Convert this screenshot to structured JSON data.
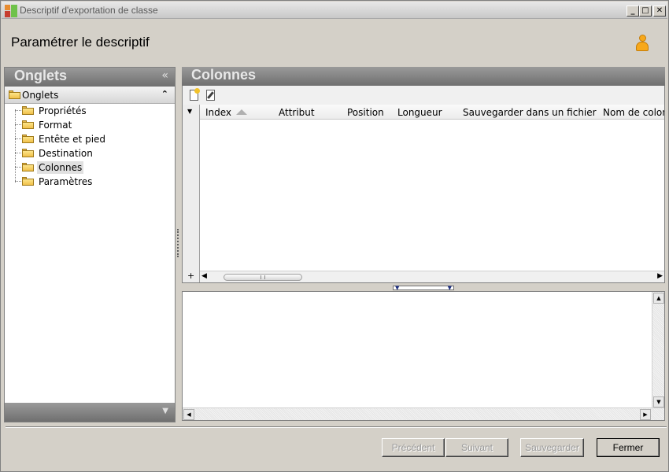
{
  "window": {
    "title": "Descriptif d'exportation de classe",
    "min_label": "_",
    "max_label": "□",
    "close_label": "✕"
  },
  "header": {
    "title": "Paramétrer le descriptif"
  },
  "left_pane": {
    "title": "Onglets",
    "collapse_glyph": "«",
    "group_label": "Onglets",
    "group_toggle": "⌃",
    "footer_glyph": "▼",
    "items": [
      {
        "label": "Propriétés"
      },
      {
        "label": "Format"
      },
      {
        "label": "Entête et pied"
      },
      {
        "label": "Destination"
      },
      {
        "label": "Colonnes",
        "selected": true
      },
      {
        "label": "Paramètres"
      }
    ]
  },
  "right_pane": {
    "title": "Colonnes",
    "columns": [
      "Index",
      "Attribut",
      "Position",
      "Longueur",
      "Sauvegarder dans un fichier",
      "Nom de colonne"
    ],
    "row_dropdown_glyph": "▼",
    "add_row_glyph": "+",
    "scroll_left_glyph": "◀",
    "scroll_right_glyph": "▶",
    "scroll_up_glyph": "▲",
    "scroll_down_glyph": "▼",
    "splitter_glyph": "▼"
  },
  "buttons": {
    "previous": "Précédent",
    "next": "Suivant",
    "save": "Sauvegarder",
    "close": "Fermer"
  }
}
